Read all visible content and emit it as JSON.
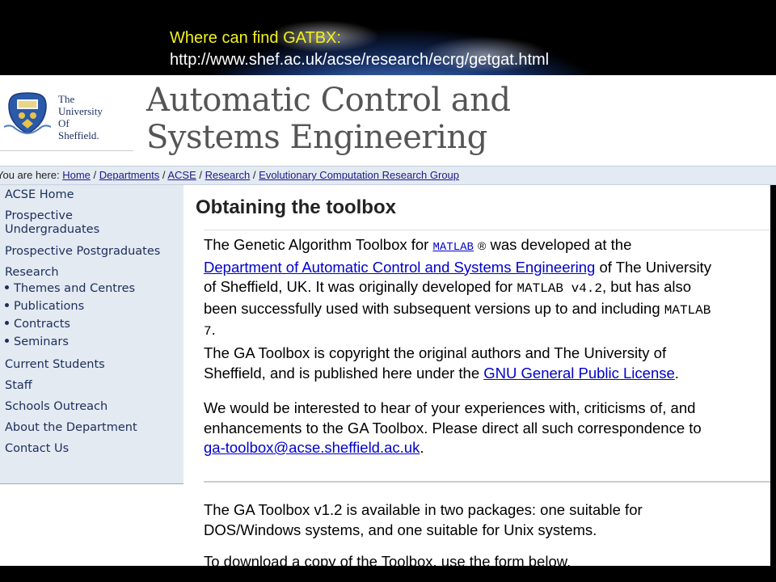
{
  "banner": {
    "line1": "Where can find GATBX:",
    "line2": "http://www.shef.ac.uk/acse/research/ecrg/getgat.html"
  },
  "logo": {
    "the": "The",
    "university": "University",
    "of": "Of",
    "sheffield": "Sheffield."
  },
  "header": {
    "title_line1": "Automatic Control and",
    "title_line2": "Systems Engineering"
  },
  "breadcrumb": {
    "lead": "You are here:",
    "items": [
      "Home",
      "Departments",
      "ACSE",
      "Research",
      "Evolutionary Computation Research Group"
    ],
    "separator": "/"
  },
  "sidebar": {
    "acse_home": "ACSE Home",
    "prospective_ug_1": "Prospective",
    "prospective_ug_2": "Undergraduates",
    "prospective_pg": "Prospective Postgraduates",
    "research": "Research",
    "sub_items": [
      "Themes and Centres",
      "Publications",
      "Contracts",
      "Seminars"
    ],
    "current_students": "Current Students",
    "staff": "Staff",
    "schools_outreach": "Schools Outreach",
    "about": "About the Department",
    "contact": "Contact Us"
  },
  "content": {
    "title": "Obtaining the toolbox",
    "p1_a": "The Genetic Algorithm Toolbox for",
    "p1_matlab_link": "MATLAB",
    "p1_reg": "®",
    "p1_b": "was developed at the",
    "p1_dept_link": "Department of Automatic Control and Systems Engineering",
    "p1_c": "of The University",
    "p1_d": "of Sheffield, UK. It was originally developed for",
    "p1_ver": "MATLAB v4.2",
    "p1_e": ", but has also",
    "p1_f": "been successfully used with subsequent versions up to and including",
    "p1_matlab": "MATLAB",
    "p1_seven": "7",
    "p1_period": ".",
    "p2_a": "The GA Toolbox is copyright the original authors and The University of",
    "p2_b": "Sheffield, and is published here under the",
    "p2_link": "GNU General Public License",
    "p2_period": ".",
    "p3_a": "We would be interested to hear of your experiences with, criticisms of, and",
    "p3_b": "enhancements to the GA Toolbox. Please direct all such correspondence to",
    "p3_email": "ga-toolbox@acse.sheffield.ac.uk",
    "p3_period": ".",
    "p4_a": "The GA Toolbox v1.2 is available in two packages: one suitable for",
    "p4_b": "DOS/Windows systems, and one suitable for Unix systems.",
    "p5_a": "To download a copy of the Toolbox, use the form below."
  },
  "colors": {
    "banner_yellow": "#f2f21c",
    "nav_bg": "#e4eaf2",
    "link_blue": "#0000cc",
    "nav_text": "#1a2e5a"
  }
}
